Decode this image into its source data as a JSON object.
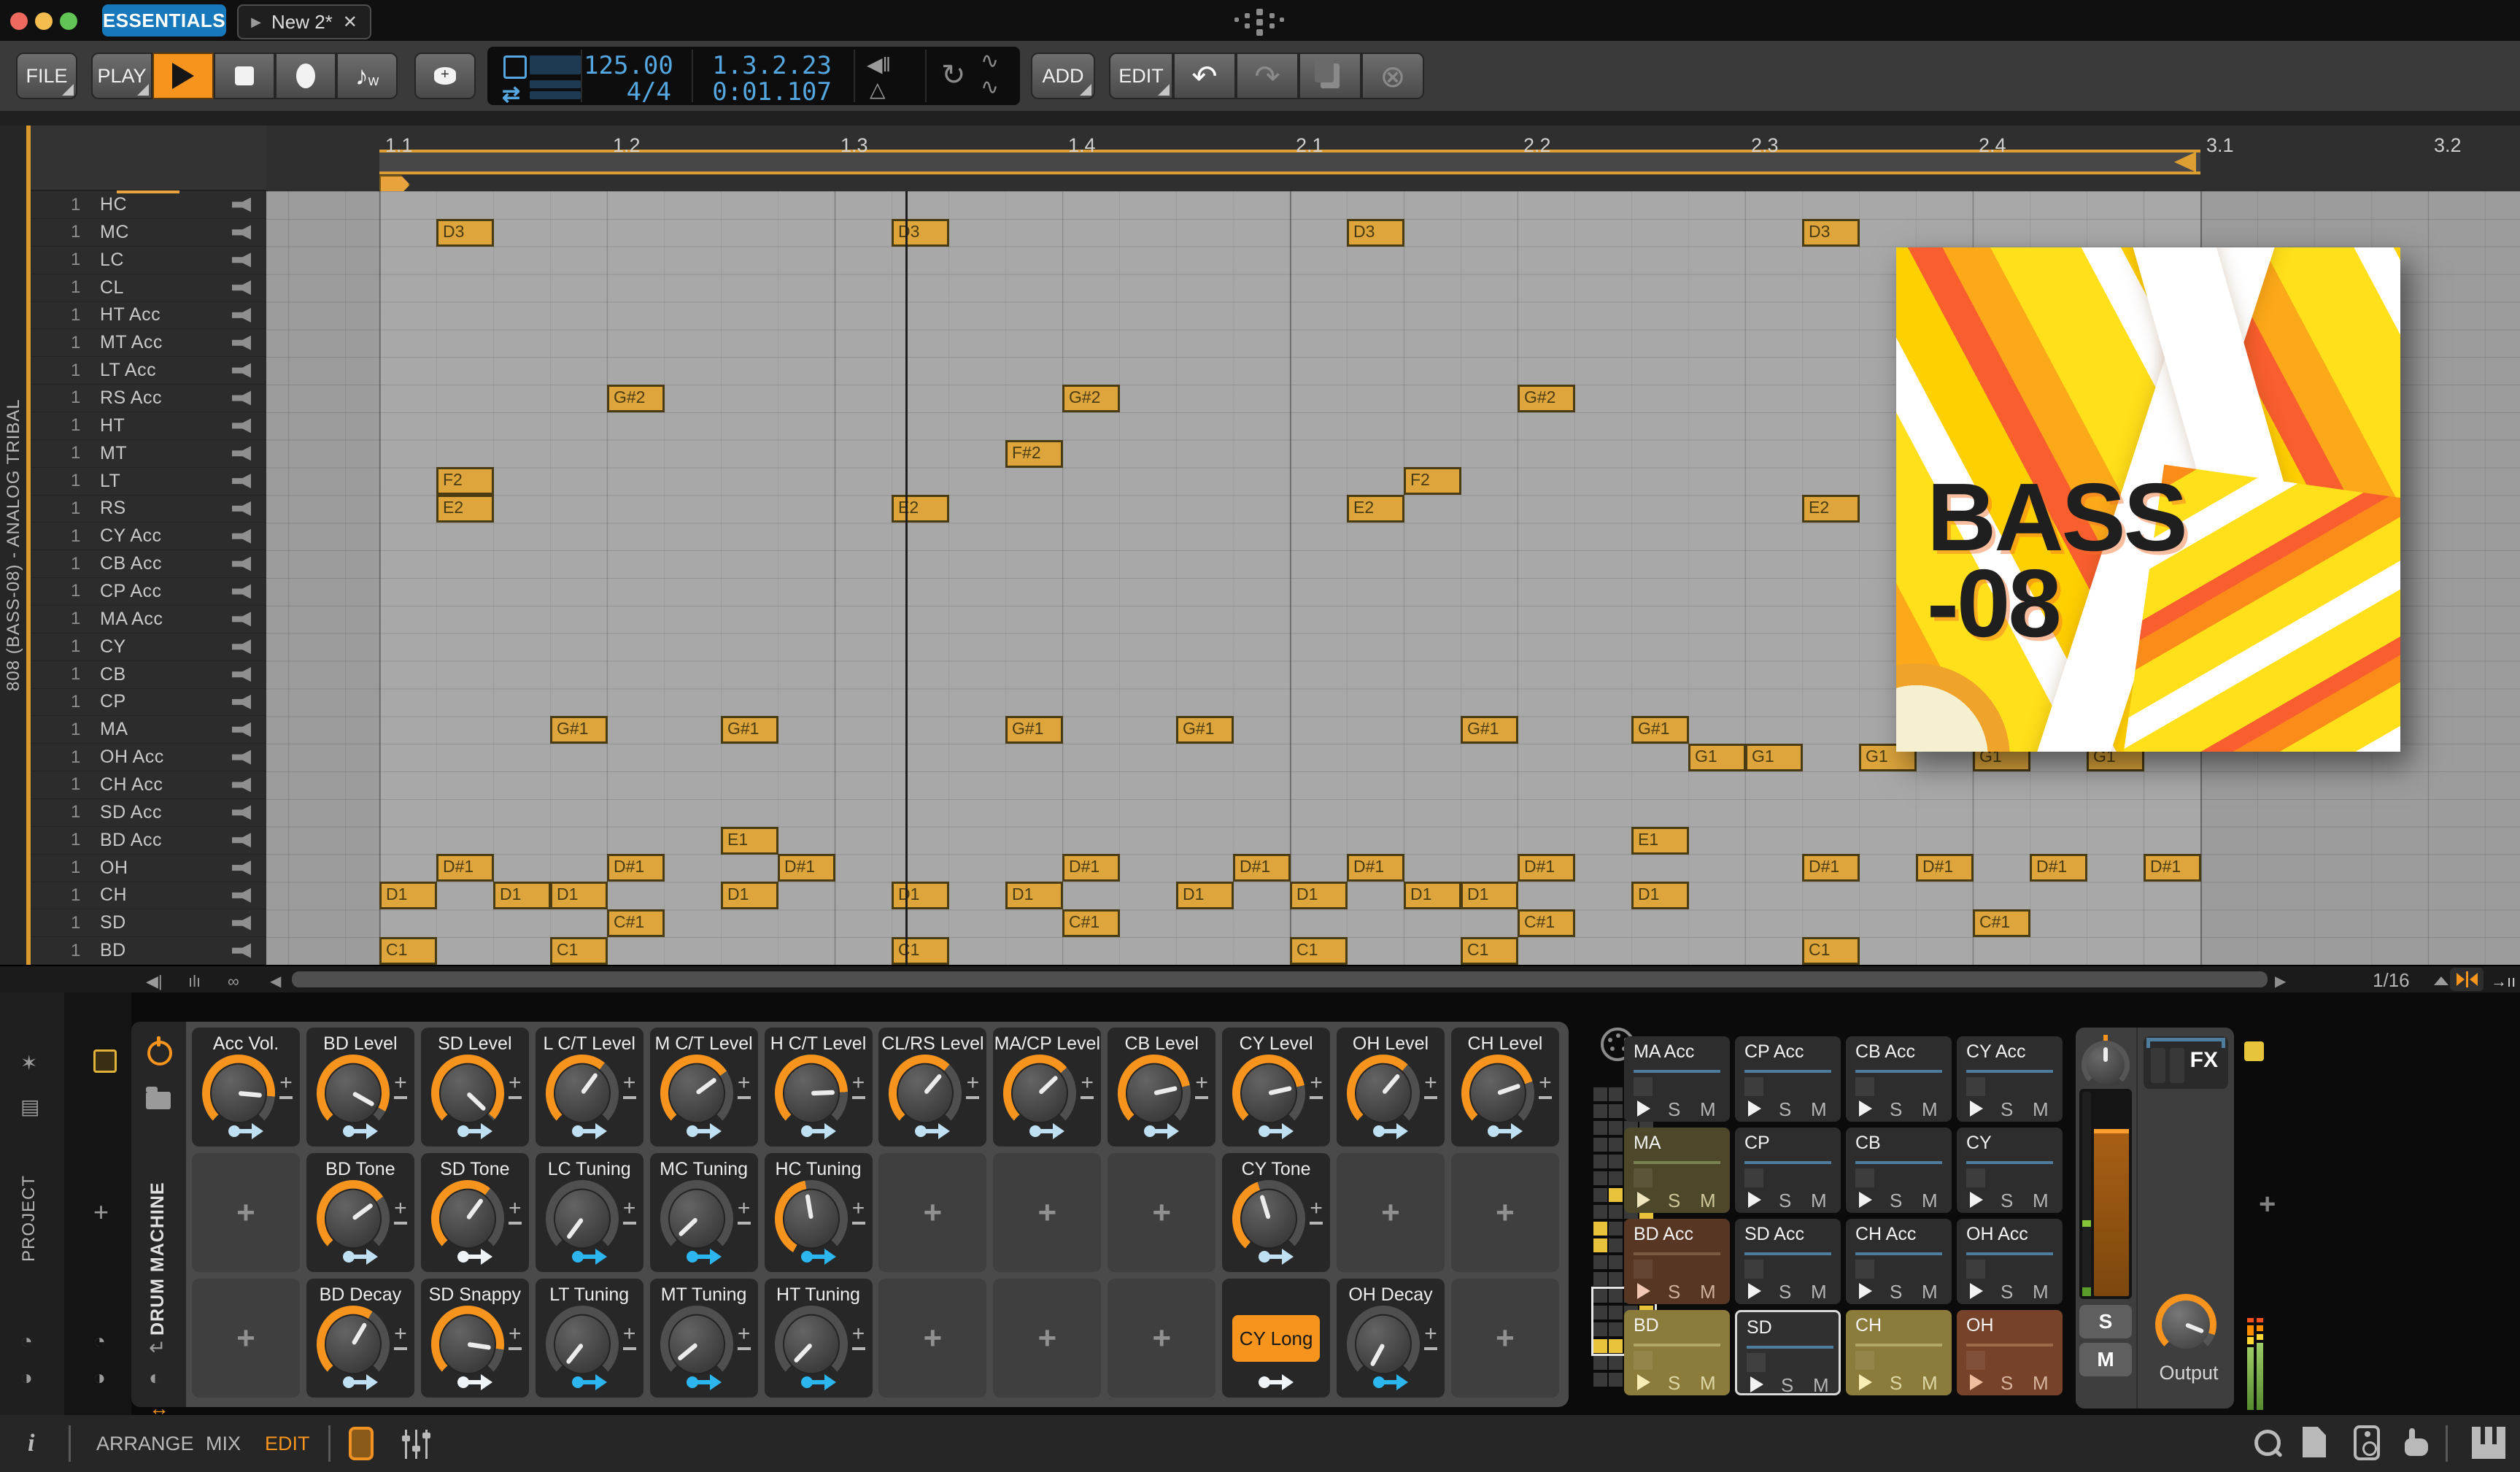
{
  "titlebar": {
    "workspace_tab": "ESSENTIALS",
    "doc_tab": "New 2*",
    "doc_close_glyph": "✕",
    "doc_play_glyph": "▶"
  },
  "transport": {
    "file": "FILE",
    "play": "PLAY",
    "add": "ADD",
    "edit": "EDIT",
    "tempo": "125.00",
    "time_signature": "4/4",
    "position": "1.3.2.23",
    "time": "0:01.107",
    "undo_glyph": "↶",
    "redo_glyph": "↷",
    "delete_glyph": "⊗",
    "loop_glyph": "↻",
    "curve_glyph": "∿",
    "overdub_glyph": "♪"
  },
  "ruler": {
    "bar_labels": [
      "1.1",
      "1.2",
      "1.3",
      "1.4",
      "2.1",
      "2.2",
      "2.3",
      "2.4",
      "3.1",
      "3.2"
    ]
  },
  "track_panel": {
    "vertical_title": "808 (BASS-08) - ANALOG TRIBAL",
    "tracks": [
      {
        "n": "1",
        "name": "HC"
      },
      {
        "n": "1",
        "name": "MC"
      },
      {
        "n": "1",
        "name": "LC"
      },
      {
        "n": "1",
        "name": "CL"
      },
      {
        "n": "1",
        "name": "HT Acc"
      },
      {
        "n": "1",
        "name": "MT Acc"
      },
      {
        "n": "1",
        "name": "LT Acc"
      },
      {
        "n": "1",
        "name": "RS Acc"
      },
      {
        "n": "1",
        "name": "HT"
      },
      {
        "n": "1",
        "name": "MT"
      },
      {
        "n": "1",
        "name": "LT"
      },
      {
        "n": "1",
        "name": "RS"
      },
      {
        "n": "1",
        "name": "CY Acc"
      },
      {
        "n": "1",
        "name": "CB Acc"
      },
      {
        "n": "1",
        "name": "CP Acc"
      },
      {
        "n": "1",
        "name": "MA Acc"
      },
      {
        "n": "1",
        "name": "CY"
      },
      {
        "n": "1",
        "name": "CB"
      },
      {
        "n": "1",
        "name": "CP"
      },
      {
        "n": "1",
        "name": "MA"
      },
      {
        "n": "1",
        "name": "OH Acc"
      },
      {
        "n": "1",
        "name": "CH Acc"
      },
      {
        "n": "1",
        "name": "SD Acc"
      },
      {
        "n": "1",
        "name": "BD Acc"
      },
      {
        "n": "1",
        "name": "OH"
      },
      {
        "n": "1",
        "name": "CH"
      },
      {
        "n": "1",
        "name": "SD"
      },
      {
        "n": "1",
        "name": "BD"
      }
    ]
  },
  "pattern": {
    "sixteenth_grid": true,
    "loop_bars": "1.1 - 3.1",
    "notes": [
      {
        "pitch": "D3",
        "lane": "MC",
        "steps": [
          1,
          9,
          17,
          25
        ]
      },
      {
        "pitch": "G#2",
        "lane": "RS Acc",
        "steps": [
          4,
          12,
          20
        ]
      },
      {
        "pitch": "F#2",
        "lane": "MT",
        "steps": [
          11
        ]
      },
      {
        "pitch": "F2",
        "lane": "LT",
        "steps": [
          1,
          18
        ]
      },
      {
        "pitch": "E2",
        "lane": "RS",
        "steps": [
          1,
          9,
          17,
          25
        ]
      },
      {
        "pitch": "G#1",
        "lane": "MA",
        "steps": [
          3,
          6,
          11,
          14,
          19,
          22
        ]
      },
      {
        "pitch": "G1",
        "lane": "OH Acc",
        "steps": [
          23,
          24,
          26,
          28,
          30
        ]
      },
      {
        "pitch": "E1",
        "lane": "BD Acc",
        "steps": [
          6,
          22
        ]
      },
      {
        "pitch": "D#1",
        "lane": "OH",
        "steps": [
          1,
          4,
          7,
          12,
          15,
          17,
          20,
          25,
          27,
          29,
          31
        ]
      },
      {
        "pitch": "D1",
        "lane": "CH",
        "steps": [
          0,
          2,
          3,
          6,
          9,
          11,
          14,
          16,
          18,
          19,
          22
        ]
      },
      {
        "pitch": "C#1",
        "lane": "SD",
        "steps": [
          4,
          12,
          20,
          28
        ]
      },
      {
        "pitch": "C1",
        "lane": "BD",
        "steps": [
          0,
          3,
          9,
          16,
          19,
          25
        ]
      }
    ]
  },
  "album_art": {
    "line1": "BASS",
    "line2": "-08"
  },
  "editor_footer": {
    "zoom_value": "1/16"
  },
  "left_rail": {
    "project_vertical": "PROJECT"
  },
  "device": {
    "header_vertical": "DRUM MACHINE",
    "cy_long_label": "CY Long",
    "rows": [
      [
        {
          "t": "knob",
          "label": "Acc Vol.",
          "ptr": 95,
          "arc": true,
          "arrow": "pale"
        },
        {
          "t": "knob",
          "label": "BD Level",
          "ptr": 118,
          "arc": true,
          "arrow": "pale"
        },
        {
          "t": "knob",
          "label": "SD Level",
          "ptr": 132,
          "arc": true,
          "arrow": "pale"
        },
        {
          "t": "knob",
          "label": "L C/T Level",
          "ptr": 38,
          "arc": true,
          "arrow": "pale"
        },
        {
          "t": "knob",
          "label": "M C/T Level",
          "ptr": 55,
          "arc": true,
          "arrow": "pale"
        },
        {
          "t": "knob",
          "label": "H C/T Level",
          "ptr": 88,
          "arc": true,
          "arrow": "pale"
        },
        {
          "t": "knob",
          "label": "CL/RS Level",
          "ptr": 42,
          "arc": true,
          "arrow": "pale"
        },
        {
          "t": "knob",
          "label": "MA/CP Level",
          "ptr": 48,
          "arc": true,
          "arrow": "pale"
        },
        {
          "t": "knob",
          "label": "CB Level",
          "ptr": 78,
          "arc": true,
          "arrow": "pale"
        },
        {
          "t": "knob",
          "label": "CY Level",
          "ptr": 78,
          "arc": true,
          "arrow": "pale"
        },
        {
          "t": "knob",
          "label": "OH Level",
          "ptr": 42,
          "arc": true,
          "arrow": "pale"
        },
        {
          "t": "knob",
          "label": "CH Level",
          "ptr": 72,
          "arc": true,
          "arrow": "pale"
        }
      ],
      [
        {
          "t": "plus"
        },
        {
          "t": "knob",
          "label": "BD Tone",
          "ptr": 55,
          "arc": true,
          "arrow": "pale"
        },
        {
          "t": "knob",
          "label": "SD Tone",
          "ptr": 38,
          "arc": true,
          "arrow": "white"
        },
        {
          "t": "knob",
          "label": "LC Tuning",
          "ptr": -142,
          "arc": false,
          "arrow": "cyan"
        },
        {
          "t": "knob",
          "label": "MC Tuning",
          "ptr": -132,
          "arc": false,
          "arrow": "cyan"
        },
        {
          "t": "knob",
          "label": "HC Tuning",
          "ptr": -10,
          "arc": [
            -150,
            -10
          ],
          "arrow": "cyan"
        },
        {
          "t": "plus"
        },
        {
          "t": "plus"
        },
        {
          "t": "plus"
        },
        {
          "t": "knob",
          "label": "CY Tone",
          "ptr": -18,
          "arc": [
            -140,
            -18
          ],
          "arrow": "pale"
        },
        {
          "t": "plus"
        },
        {
          "t": "plus"
        }
      ],
      [
        {
          "t": "plus"
        },
        {
          "t": "knob",
          "label": "BD Decay",
          "ptr": 32,
          "arc": true,
          "arrow": "pale"
        },
        {
          "t": "knob",
          "label": "SD Snappy",
          "ptr": 98,
          "arc": true,
          "arrow": "white"
        },
        {
          "t": "knob",
          "label": "LT Tuning",
          "ptr": -140,
          "arc": false,
          "arrow": "cyan"
        },
        {
          "t": "knob",
          "label": "MT Tuning",
          "ptr": -128,
          "arc": false,
          "arrow": "cyan"
        },
        {
          "t": "knob",
          "label": "HT Tuning",
          "ptr": -135,
          "arc": false,
          "arrow": "cyan"
        },
        {
          "t": "plus"
        },
        {
          "t": "plus"
        },
        {
          "t": "plus"
        },
        {
          "t": "button",
          "label": "CY Long",
          "arrow": "white"
        },
        {
          "t": "knob",
          "label": "OH Decay",
          "ptr": -150,
          "arc": false,
          "arrow": "cyan"
        },
        {
          "t": "plus"
        }
      ]
    ]
  },
  "pads": {
    "s": "S",
    "m": "M",
    "grid": [
      [
        {
          "label": "MA Acc",
          "bg": "#2d2d2d",
          "line": "#4e7d9e",
          "tint": "#f2f2f2",
          "sm": "#b5b5b5"
        },
        {
          "label": "CP Acc",
          "bg": "#2d2d2d",
          "line": "#4e7d9e",
          "tint": "#f2f2f2",
          "sm": "#b5b5b5"
        },
        {
          "label": "CB Acc",
          "bg": "#2d2d2d",
          "line": "#4e7d9e",
          "tint": "#f2f2f2",
          "sm": "#b5b5b5"
        },
        {
          "label": "CY Acc",
          "bg": "#2d2d2d",
          "line": "#4e7d9e",
          "tint": "#f2f2f2",
          "sm": "#b5b5b5"
        }
      ],
      [
        {
          "label": "MA",
          "bg": "#4e482a",
          "line": "#7a8252",
          "tint": "#efe6c0",
          "sm": "#cfc69a"
        },
        {
          "label": "CP",
          "bg": "#2d2d2d",
          "line": "#4e7d9e",
          "tint": "#f2f2f2",
          "sm": "#b5b5b5"
        },
        {
          "label": "CB",
          "bg": "#2d2d2d",
          "line": "#4e7d9e",
          "tint": "#f2f2f2",
          "sm": "#b5b5b5"
        },
        {
          "label": "CY",
          "bg": "#2d2d2d",
          "line": "#4e7d9e",
          "tint": "#f2f2f2",
          "sm": "#b5b5b5"
        }
      ],
      [
        {
          "label": "BD Acc",
          "bg": "#573623",
          "line": "#7a5a42",
          "tint": "#f2c7b3",
          "sm": "#cdb09a"
        },
        {
          "label": "SD Acc",
          "bg": "#2d2d2d",
          "line": "#4e7d9e",
          "tint": "#f2f2f2",
          "sm": "#b5b5b5"
        },
        {
          "label": "CH Acc",
          "bg": "#2d2d2d",
          "line": "#4e7d9e",
          "tint": "#f2f2f2",
          "sm": "#b5b5b5"
        },
        {
          "label": "OH Acc",
          "bg": "#2d2d2d",
          "line": "#4e7d9e",
          "tint": "#f2f2f2",
          "sm": "#b5b5b5"
        }
      ],
      [
        {
          "label": "BD",
          "bg": "#8b7c3c",
          "line": "#b0a765",
          "tint": "#f7edb5",
          "sm": "#ded7a5"
        },
        {
          "label": "SD",
          "bg": "#303030",
          "line": "#4e7d9e",
          "tint": "#f2f2f2",
          "sm": "#b5b5b5",
          "sel": true
        },
        {
          "label": "CH",
          "bg": "#8b7c3c",
          "line": "#b0a765",
          "tint": "#f7edb5",
          "sm": "#ded7a5"
        },
        {
          "label": "OH",
          "bg": "#76422a",
          "line": "#9a6a4a",
          "tint": "#f0bd9e",
          "sm": "#d8b49e"
        }
      ]
    ]
  },
  "channel": {
    "solo": "S",
    "mute": "M",
    "fx_label": "FX",
    "output_label": "Output"
  },
  "statusbar": {
    "info": "i",
    "arrange": "ARRANGE",
    "mix": "MIX",
    "edit": "EDIT"
  },
  "colors": {
    "accent_orange": "#f7941e",
    "note_fill": "#dda53c",
    "display_blue": "#54a7e0",
    "loop_orange": "#dd9e33",
    "pad_blue_line": "#4e7d9e"
  }
}
